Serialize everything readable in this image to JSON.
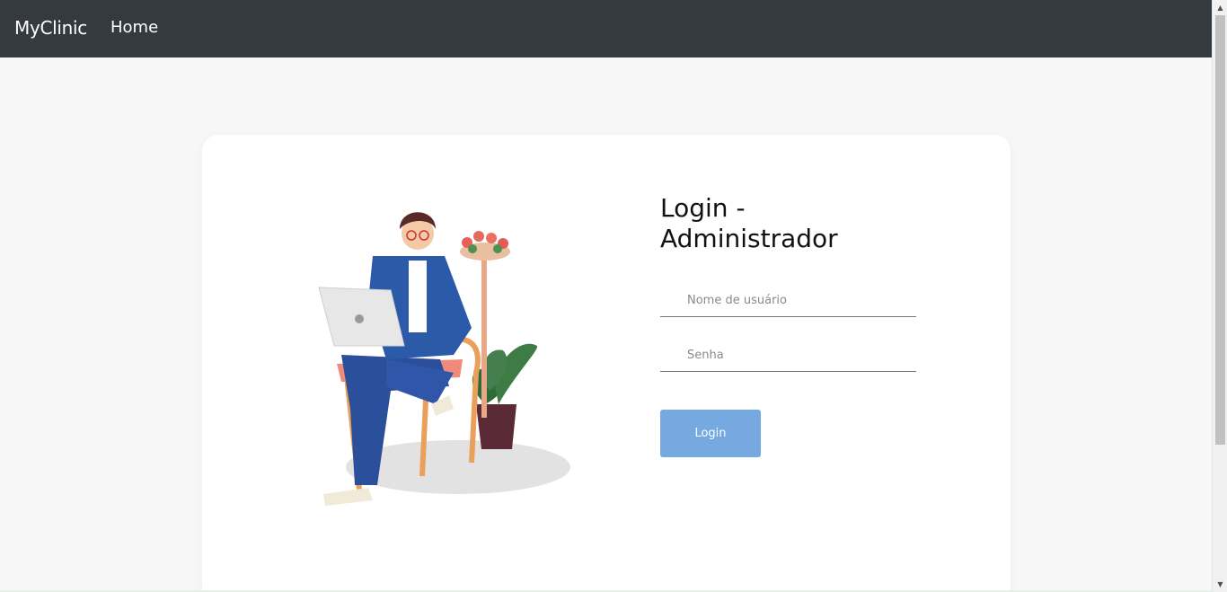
{
  "navbar": {
    "brand": "MyClinic",
    "home": "Home"
  },
  "login": {
    "title": "Login - Administrador",
    "username_placeholder": "Nome de usuário",
    "password_placeholder": "Senha",
    "button_label": "Login"
  },
  "colors": {
    "navbar_bg": "#343a40",
    "page_bg": "#f7f7f7",
    "button_bg": "#75a9e0"
  }
}
